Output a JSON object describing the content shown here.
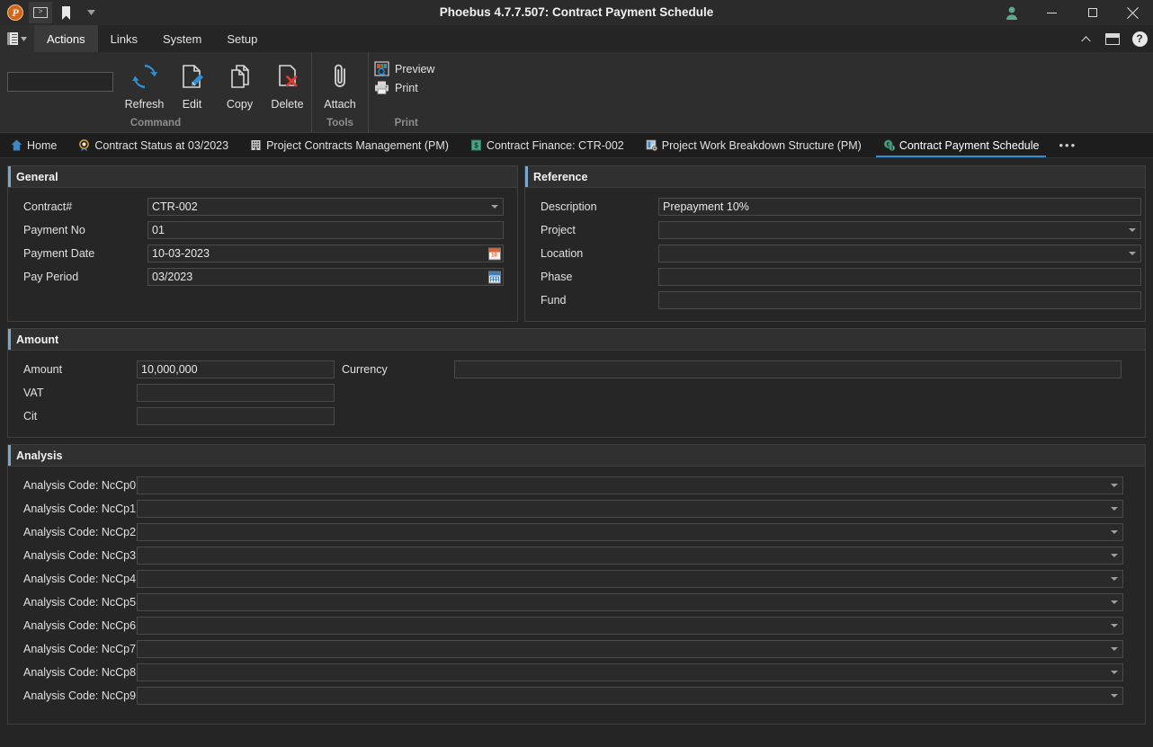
{
  "window": {
    "title": "Phoebus 4.7.7.507: Contract Payment Schedule",
    "quick_access": {
      "logo": "phoebus-logo",
      "command_prompt": "command-prompt-icon",
      "bookmark": "bookmark-icon",
      "overflow": "chevron-down-icon"
    },
    "controls": {
      "user": "user-icon",
      "minimize": "minimize-icon",
      "maximize": "maximize-icon",
      "close": "close-icon"
    }
  },
  "menubar": {
    "app_button": "application-menu-icon",
    "items": [
      {
        "label": "Actions",
        "active": true
      },
      {
        "label": "Links",
        "active": false
      },
      {
        "label": "System",
        "active": false
      },
      {
        "label": "Setup",
        "active": false
      }
    ],
    "right_icons": [
      {
        "name": "collapse-ribbon-icon",
        "glyph": "˄"
      },
      {
        "name": "restore-window-icon",
        "glyph": "box"
      },
      {
        "name": "help-icon",
        "glyph": "?"
      }
    ]
  },
  "ribbon": {
    "search": {
      "value": "",
      "placeholder": ""
    },
    "groups": [
      {
        "name": "Command",
        "buttons": [
          {
            "label": "Refresh",
            "icon": "refresh-icon"
          },
          {
            "label": "Edit",
            "icon": "edit-icon"
          },
          {
            "label": "Copy",
            "icon": "copy-icon"
          },
          {
            "label": "Delete",
            "icon": "delete-icon"
          }
        ]
      },
      {
        "name": "Tools",
        "buttons": [
          {
            "label": "Attach",
            "icon": "attach-icon"
          }
        ]
      },
      {
        "name": "Print",
        "buttons": [
          {
            "label": "Preview",
            "icon": "preview-icon"
          },
          {
            "label": "Print",
            "icon": "print-icon"
          }
        ]
      }
    ]
  },
  "tabs": {
    "items": [
      {
        "label": "Home",
        "icon": "home-icon",
        "active": false
      },
      {
        "label": "Contract Status at 03/2023",
        "icon": "medal-icon",
        "active": false
      },
      {
        "label": "Project Contracts Management (PM)",
        "icon": "building-icon",
        "active": false
      },
      {
        "label": "Contract Finance: CTR-002",
        "icon": "money-icon",
        "active": false
      },
      {
        "label": "Project Work Breakdown Structure (PM)",
        "icon": "structure-icon",
        "active": false
      },
      {
        "label": "Contract Payment Schedule",
        "icon": "currency-settings-icon",
        "active": true
      }
    ],
    "overflow": "•••"
  },
  "sections": {
    "general": {
      "title": "General",
      "fields": [
        {
          "label": "Contract#",
          "value": "CTR-002",
          "type": "combo"
        },
        {
          "label": "Payment No",
          "value": "01",
          "type": "text"
        },
        {
          "label": "Payment Date",
          "value": "10-03-2023",
          "type": "date"
        },
        {
          "label": "Pay Period",
          "value": "03/2023",
          "type": "month"
        }
      ]
    },
    "reference": {
      "title": "Reference",
      "fields": [
        {
          "label": "Description",
          "value": "Prepayment 10%",
          "type": "text"
        },
        {
          "label": "Project",
          "value": "",
          "type": "combo"
        },
        {
          "label": "Location",
          "value": "",
          "type": "combo"
        },
        {
          "label": "Phase",
          "value": "",
          "type": "text"
        },
        {
          "label": "Fund",
          "value": "",
          "type": "text"
        }
      ]
    },
    "amount": {
      "title": "Amount",
      "fields": [
        {
          "label": "Amount",
          "value": "10,000,000",
          "type": "text"
        },
        {
          "label": "VAT",
          "value": "",
          "type": "text"
        },
        {
          "label": "Cit",
          "value": "",
          "type": "text"
        }
      ],
      "currency": {
        "label": "Currency",
        "value": "",
        "type": "text"
      }
    },
    "analysis": {
      "title": "Analysis",
      "fields": [
        {
          "label": "Analysis Code: NcCp0",
          "value": "",
          "type": "combo"
        },
        {
          "label": "Analysis Code: NcCp1",
          "value": "",
          "type": "combo"
        },
        {
          "label": "Analysis Code: NcCp2",
          "value": "",
          "type": "combo"
        },
        {
          "label": "Analysis Code: NcCp3",
          "value": "",
          "type": "combo"
        },
        {
          "label": "Analysis Code: NcCp4",
          "value": "",
          "type": "combo"
        },
        {
          "label": "Analysis Code: NcCp5",
          "value": "",
          "type": "combo"
        },
        {
          "label": "Analysis Code: NcCp6",
          "value": "",
          "type": "combo"
        },
        {
          "label": "Analysis Code: NcCp7",
          "value": "",
          "type": "combo"
        },
        {
          "label": "Analysis Code: NcCp8",
          "value": "",
          "type": "combo"
        },
        {
          "label": "Analysis Code: NcCp9",
          "value": "",
          "type": "combo"
        }
      ]
    }
  },
  "colors": {
    "app_bg": "#252526",
    "titlebar_bg": "#2b2b2b",
    "ribbon_bg": "#2e2e2e",
    "panel_header_bg": "#303030",
    "accent_blue": "#2e8fd6",
    "panel_accent": "#7ba7cf",
    "text": "#e0e0e0",
    "logo_orange": "#d2651c"
  }
}
